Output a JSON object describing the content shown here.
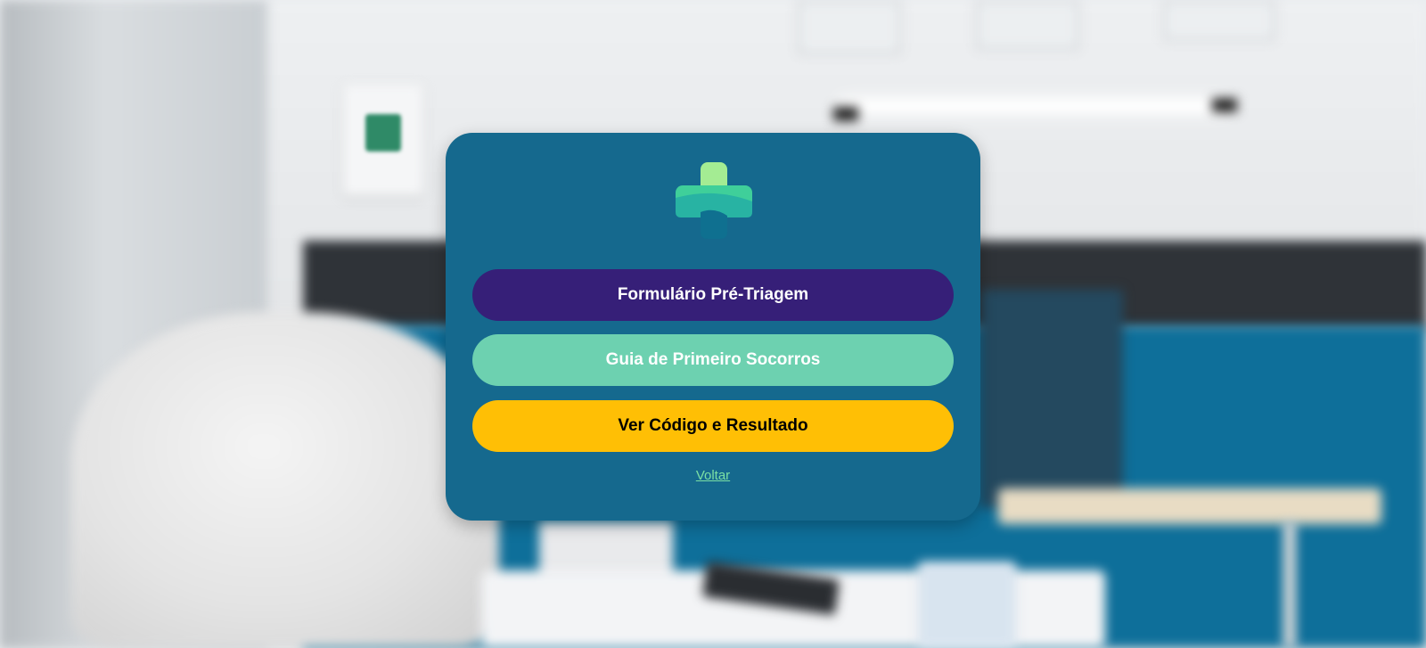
{
  "page": {
    "background_description_icon": "clinic-room-blurred-background"
  },
  "card": {
    "logo_icon": "medical-cross-logo",
    "buttons": [
      {
        "label": "Formulário Pré-Triagem",
        "color": "#361f78",
        "text_color": "#ffffff"
      },
      {
        "label": "Guia de Primeiro Socorros",
        "color": "#6dd1b0",
        "text_color": "#ffffff"
      },
      {
        "label": "Ver Código e Resultado",
        "color": "#ffbf05",
        "text_color": "#000000"
      }
    ],
    "back_link": "Voltar",
    "background_color": "#15698e"
  }
}
